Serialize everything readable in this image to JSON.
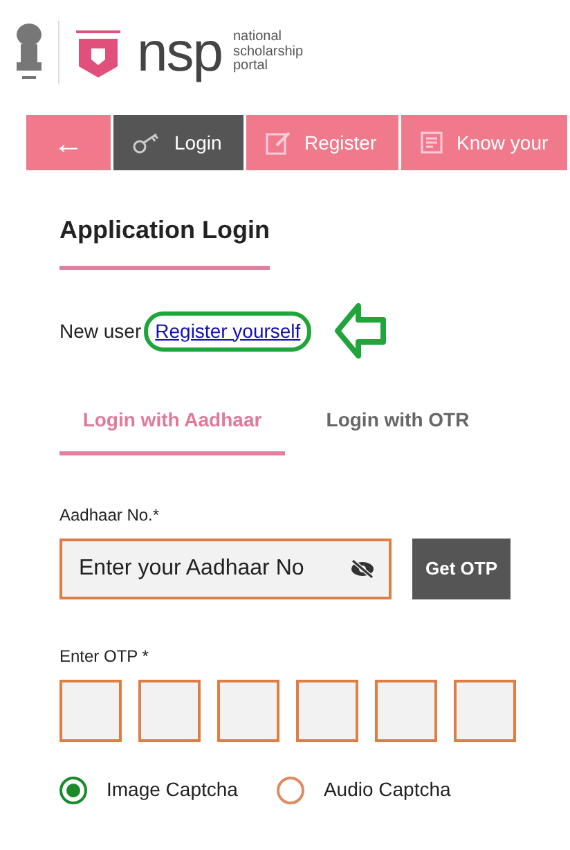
{
  "header": {
    "logo_text": "nsp",
    "logo_caption": [
      "national",
      "scholarship",
      "portal"
    ]
  },
  "nav_tabs": [
    {
      "kind": "back",
      "label": "←",
      "selected": false
    },
    {
      "kind": "key",
      "label": "Login",
      "selected": true
    },
    {
      "kind": "edit",
      "label": "Register",
      "selected": false
    },
    {
      "kind": "doc",
      "label": "Know your",
      "selected": false
    }
  ],
  "title": "Application Login",
  "new_user": {
    "text": "New user",
    "link": "Register yourself"
  },
  "login_tabs": [
    {
      "label": "Login with Aadhaar",
      "selected": true
    },
    {
      "label": "Login with OTR",
      "selected": false
    }
  ],
  "aadhaar": {
    "label": "Aadhaar No.*",
    "placeholder": "Enter your Aadhaar No",
    "button": "Get OTP"
  },
  "otp": {
    "label": "Enter OTP *"
  },
  "captcha_options": [
    {
      "label": "Image Captcha",
      "selected": true
    },
    {
      "label": "Audio Captcha",
      "selected": false
    }
  ]
}
